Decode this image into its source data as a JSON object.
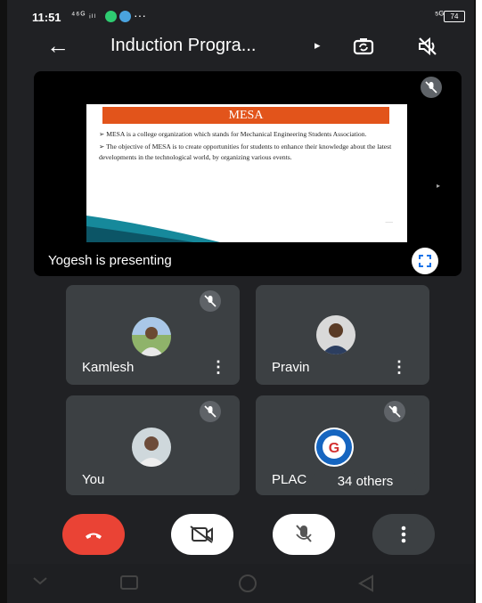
{
  "status_bar": {
    "time": "11:51",
    "signal": "⁴⁶ᴳ ᵢₗₗ",
    "more": "···",
    "network": "⁵ᴳ",
    "battery": "74"
  },
  "top_bar": {
    "title": "Induction Progra...",
    "play_glyph": "▸"
  },
  "presentation": {
    "presenter_label": "Yogesh is presenting",
    "slide": {
      "heading": "MESA",
      "bullets": [
        "MESA is a college organization which stands for Mechanical Engineering Students Association.",
        "The objective of MESA is to create opportunities for students to enhance their knowledge about the latest developments in the technological world, by organizing various events."
      ]
    }
  },
  "participants": [
    {
      "name": "Kamlesh"
    },
    {
      "name": "Pravin"
    },
    {
      "name": "You"
    },
    {
      "name": "PLAC"
    }
  ],
  "others_label": "34 others",
  "colors": {
    "background": "#202124",
    "tile": "#3c4043",
    "end_call": "#ea4335",
    "slide_header": "#e2541b"
  }
}
